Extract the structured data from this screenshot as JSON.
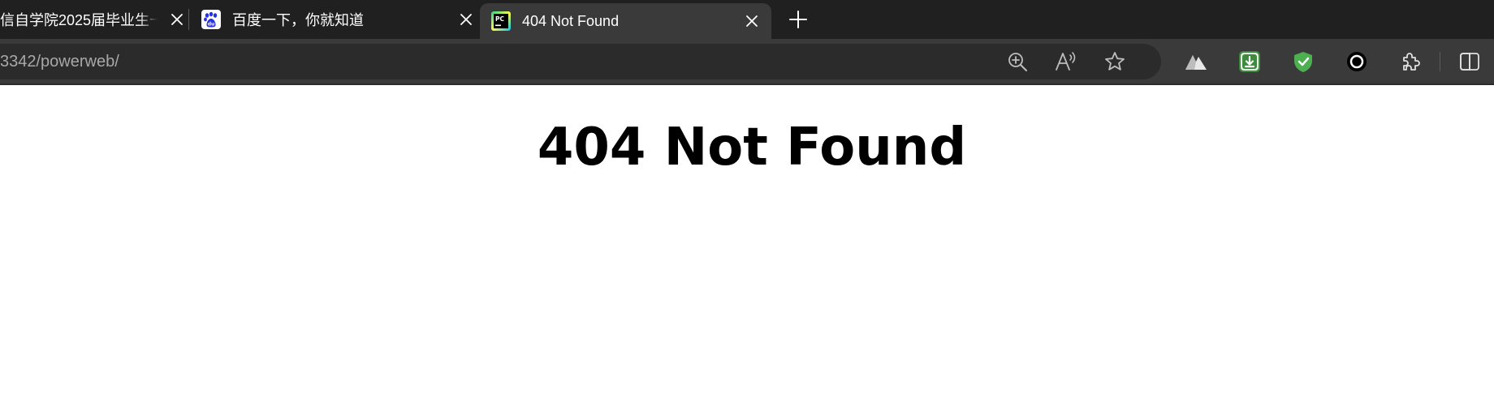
{
  "tabs": [
    {
      "title": "信自学院2025届毕业生一",
      "icon": "none",
      "active": false
    },
    {
      "title": "百度一下，你就知道",
      "icon": "baidu-paw-icon",
      "active": false
    },
    {
      "title": "404 Not Found",
      "icon": "pycharm-icon",
      "active": true
    }
  ],
  "address_bar": {
    "url": "3342/powerweb/"
  },
  "toolbar": {
    "icons": [
      "zoom-in-icon",
      "read-aloud-icon",
      "favorite-star-icon",
      "mountain-extension-icon",
      "download-extension-icon",
      "shield-check-extension-icon",
      "circle-extension-icon",
      "extensions-puzzle-icon",
      "split-screen-icon"
    ]
  },
  "page": {
    "heading": "404 Not Found"
  },
  "colors": {
    "tabstrip_bg": "#202020",
    "active_tab_bg": "#3a3a3a",
    "address_bg": "#2b2b2b",
    "content_bg": "#ffffff",
    "shield_green": "#4caf50",
    "download_green": "#3d8b3d"
  }
}
